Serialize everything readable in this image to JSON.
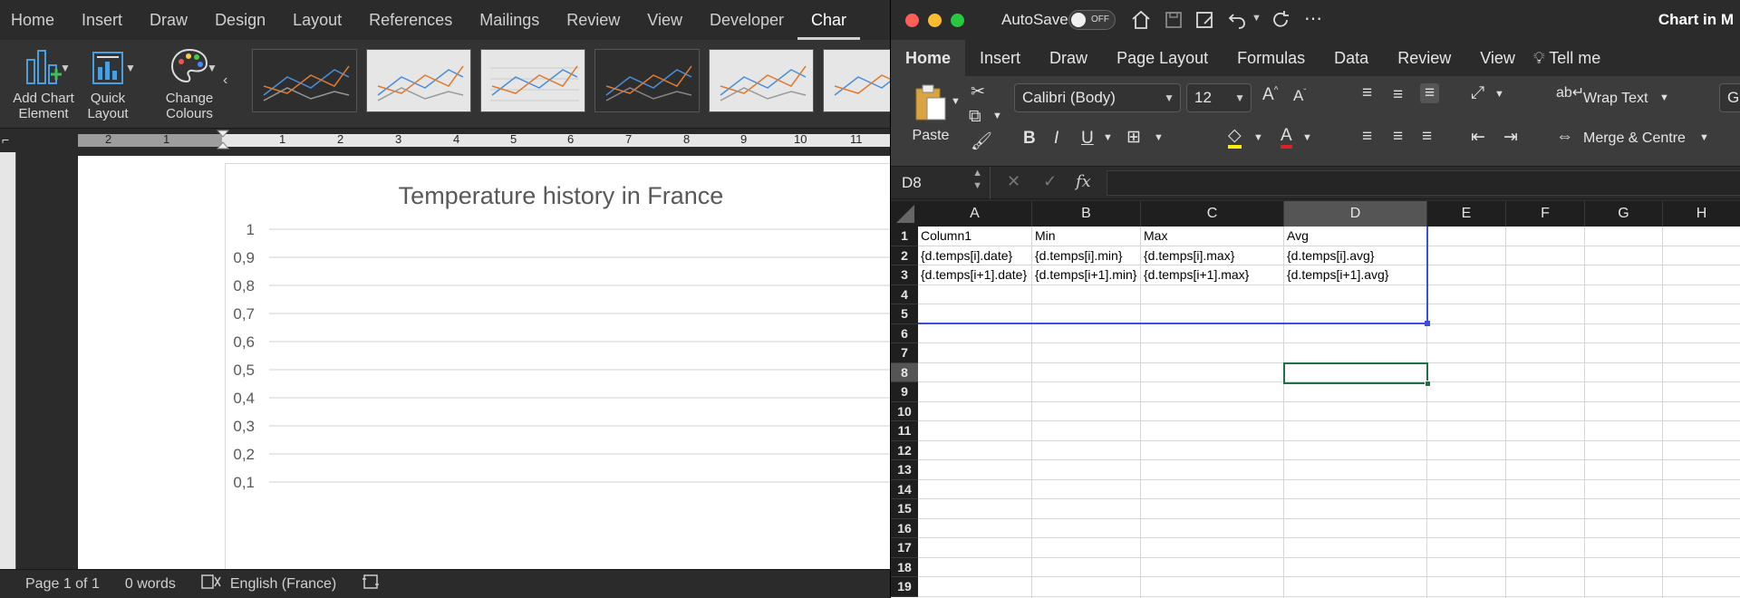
{
  "word": {
    "tabs": [
      "Home",
      "Insert",
      "Draw",
      "Design",
      "Layout",
      "References",
      "Mailings",
      "Review",
      "View",
      "Developer",
      "Char"
    ],
    "ribbon": {
      "add_chart_element": "Add Chart Element",
      "quick_layout": "Quick Layout",
      "change_colours": "Change Colours"
    },
    "ruler_numbers": [
      "2",
      "1",
      "1",
      "2",
      "3",
      "4",
      "5",
      "6",
      "7",
      "8",
      "9",
      "10",
      "11"
    ],
    "chart": {
      "title": "Temperature history in France",
      "y_ticks": [
        "1",
        "0,9",
        "0,8",
        "0,7",
        "0,6",
        "0,5",
        "0,4",
        "0,3",
        "0,2",
        "0,1"
      ]
    },
    "status": {
      "page": "Page 1 of 1",
      "words": "0 words",
      "language": "English (France)"
    }
  },
  "excel": {
    "autosave_label": "AutoSave",
    "autosave_state": "OFF",
    "window_title": "Chart in M",
    "tabs": [
      "Home",
      "Insert",
      "Draw",
      "Page Layout",
      "Formulas",
      "Data",
      "Review",
      "View",
      "Tell me"
    ],
    "ribbon": {
      "paste": "Paste",
      "font_name": "Calibri (Body)",
      "font_size": "12",
      "wrap_text": "Wrap Text",
      "merge_centre": "Merge & Centre",
      "general_partial": "Ge"
    },
    "name_box": "D8",
    "formula_fx": "fx",
    "columns": [
      "A",
      "B",
      "C",
      "D",
      "E",
      "F",
      "G",
      "H"
    ],
    "rows": [
      "1",
      "2",
      "3",
      "4",
      "5",
      "6",
      "7",
      "8",
      "9",
      "10",
      "11",
      "12",
      "13",
      "14",
      "15",
      "16",
      "17",
      "18",
      "19"
    ],
    "cells": {
      "A1": "Column1",
      "B1": "Min",
      "C1": "Max",
      "D1": "Avg",
      "A2": "{d.temps[i].date}",
      "B2": "{d.temps[i].min}",
      "C2": "{d.temps[i].max}",
      "D2": "{d.temps[i].avg}",
      "A3": "{d.temps[i+1].date}",
      "B3": "{d.temps[i+1].min}",
      "C3": "{d.temps[i+1].max}",
      "D3": "{d.temps[i+1].avg}"
    },
    "selected_cell": "D8",
    "colors": {
      "selection": "#1e7145",
      "table_border": "#3b4fd8"
    }
  }
}
